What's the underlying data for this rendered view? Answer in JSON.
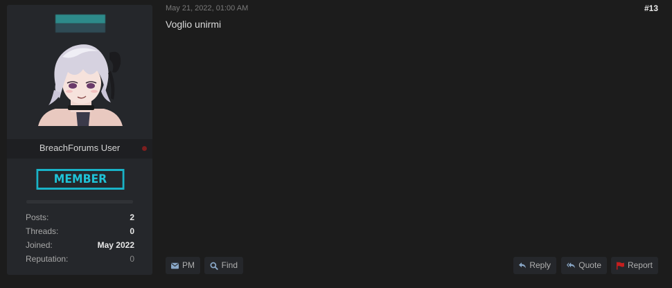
{
  "author": {
    "usertitle": "BreachForums User",
    "rank_badge": "MEMBER",
    "online_status_color": "#7d1f1f",
    "stats": [
      {
        "label": "Posts:",
        "value": "2",
        "muted": false
      },
      {
        "label": "Threads:",
        "value": "0",
        "muted": false
      },
      {
        "label": "Joined:",
        "value": "May 2022",
        "muted": false
      },
      {
        "label": "Reputation:",
        "value": "0",
        "muted": true
      }
    ]
  },
  "post": {
    "date": "May 21, 2022, 01:00 AM",
    "number": "#13",
    "content": "Voglio unirmi"
  },
  "buttons": {
    "pm": "PM",
    "find": "Find",
    "reply": "Reply",
    "quote": "Quote",
    "report": "Report"
  },
  "colors": {
    "accent": "#1fc3d7",
    "icon_blue": "#8aa8c8",
    "report_flag": "#c41e1e",
    "background": "#1c1c1c",
    "panel": "#25272b"
  },
  "icons": {
    "pm": "envelope-icon",
    "find": "search-icon",
    "reply": "reply-icon",
    "quote": "reply-all-icon",
    "report": "flag-icon",
    "status": "offline-dot-icon"
  }
}
